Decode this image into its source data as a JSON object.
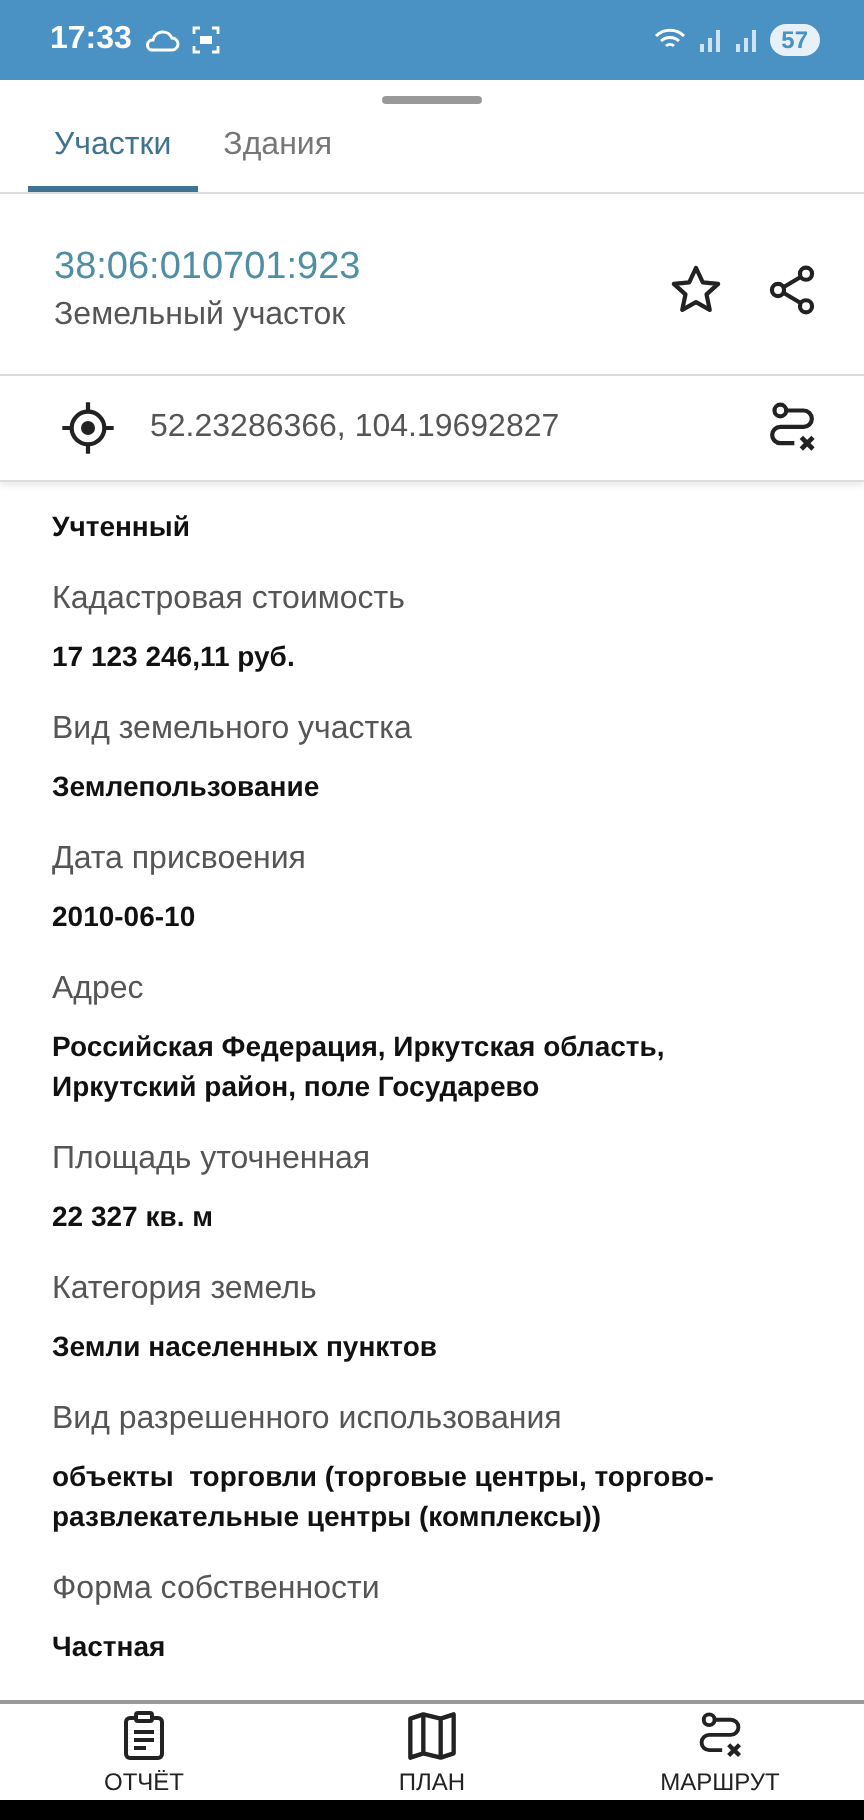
{
  "status_bar": {
    "time": "17:33",
    "battery": "57"
  },
  "tabs": [
    {
      "label": "Участки",
      "selected": true
    },
    {
      "label": "Здания",
      "selected": false
    }
  ],
  "header": {
    "cadastral_number": "38:06:010701:923",
    "type": "Земельный участок",
    "favorite": false
  },
  "coordinates": "52.23286366, 104.19692827",
  "fields": [
    {
      "value": "Учтенный"
    },
    {
      "label": "Кадастровая стоимость",
      "value": "17 123 246,11 руб."
    },
    {
      "label": "Вид земельного участка",
      "value": "Землепользование"
    },
    {
      "label": "Дата присвоения",
      "value": "2010-06-10"
    },
    {
      "label": "Адрес",
      "value": "Российская Федерация, Иркутская область, Иркутский район, поле Государево"
    },
    {
      "label": "Площадь уточненная",
      "value": "22 327 кв. м"
    },
    {
      "label": "Категория земель",
      "value": "Земли населенных пунктов"
    },
    {
      "label": "Вид разрешенного использования",
      "value": "объекты  торговли (торговые центры, торгово-развлекательные центры (комплексы))"
    },
    {
      "label": "Форма собственности",
      "value": "Частная"
    }
  ],
  "bottom_nav": [
    {
      "kind": "report",
      "label": "ОТЧЁТ"
    },
    {
      "kind": "plan",
      "label": "ПЛАН"
    },
    {
      "kind": "route",
      "label": "МАРШРУТ"
    }
  ]
}
